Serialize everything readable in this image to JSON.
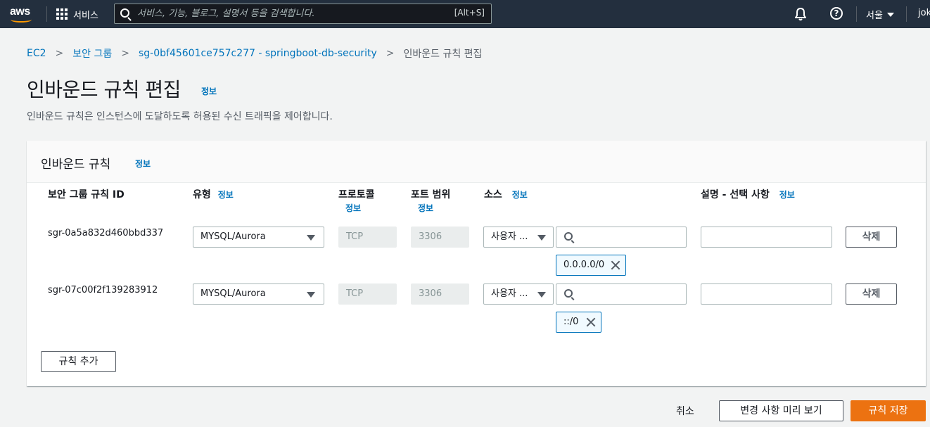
{
  "nav": {
    "logo": "aws",
    "services_label": "서비스",
    "search_placeholder": "서비스, 기능, 블로그, 설명서 등을 검색합니다.",
    "search_shortcut": "[Alt+S]",
    "region": "서울",
    "user": "jok",
    "help_glyph": "?"
  },
  "breadcrumb": {
    "items": [
      "EC2",
      "보안 그룹",
      "sg-0bf45601ce757c277 - springboot-db-security"
    ],
    "current": "인바운드 규칙 편집",
    "separator": ">"
  },
  "page": {
    "title": "인바운드 규칙 편집",
    "info": "정보",
    "description": "인바운드 규칙은 인스턴스에 도달하도록 허용된 수신 트래픽을 제어합니다."
  },
  "panel": {
    "title": "인바운드 규칙",
    "info": "정보",
    "columns": {
      "rule_id": "보안 그룹 규칙 ID",
      "type": "유형",
      "protocol": "프로토콜",
      "port_range": "포트 범위",
      "source": "소스",
      "description": "설명 - 선택 사항",
      "info": "정보"
    },
    "rules": [
      {
        "id": "sgr-0a5a832d460bbd337",
        "type": "MYSQL/Aurora",
        "protocol": "TCP",
        "port": "3306",
        "source_type": "사용자 ...",
        "source_token": "0.0.0.0/0",
        "delete": "삭제"
      },
      {
        "id": "sgr-07c00f2f139283912",
        "type": "MYSQL/Aurora",
        "protocol": "TCP",
        "port": "3306",
        "source_type": "사용자 ...",
        "source_token": "::/0",
        "delete": "삭제"
      }
    ],
    "add_rule": "규칙 추가"
  },
  "footer": {
    "cancel": "취소",
    "preview": "변경 사항 미리 보기",
    "save": "규칙 저장"
  },
  "colors": {
    "nav_bg": "#232f3e",
    "link": "#0073bb",
    "primary": "#ec7211",
    "aws_orange": "#ff9900"
  }
}
